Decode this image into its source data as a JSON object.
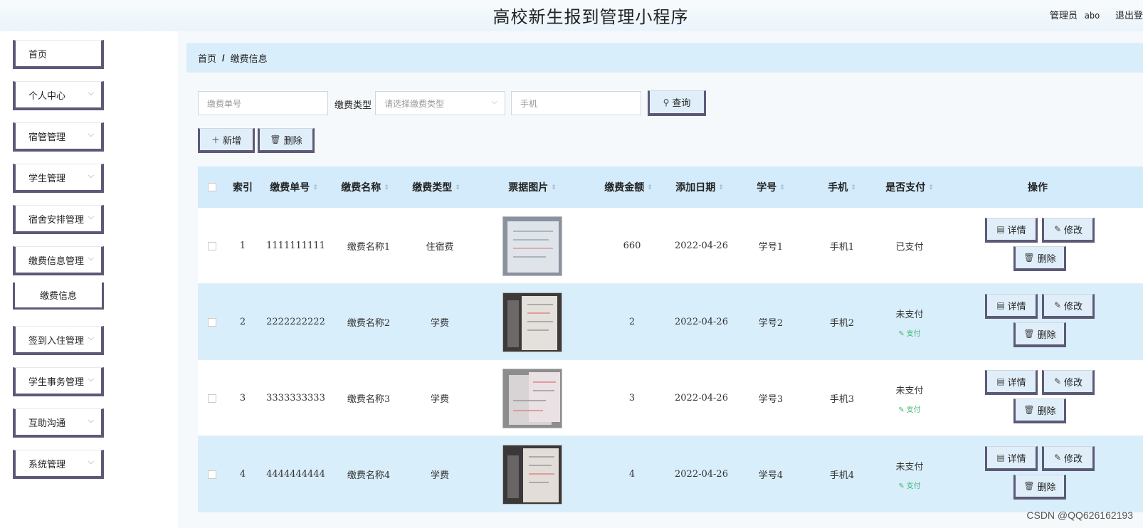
{
  "header": {
    "title": "高校新生报到管理小程序",
    "user_role": "管理员",
    "user_name": "abo",
    "logout": "退出登"
  },
  "sidebar": {
    "items": [
      {
        "label": "首页"
      },
      {
        "label": "个人中心"
      },
      {
        "label": "宿管管理"
      },
      {
        "label": "学生管理"
      },
      {
        "label": "宿舍安排管理"
      },
      {
        "label": "缴费信息管理"
      },
      {
        "label": "缴费信息"
      },
      {
        "label": "签到入住管理"
      },
      {
        "label": "学生事务管理"
      },
      {
        "label": "互助沟通"
      },
      {
        "label": "系统管理"
      }
    ]
  },
  "breadcrumb": {
    "home": "首页",
    "sep": "/",
    "current": "缴费信息"
  },
  "filters": {
    "order_placeholder": "缴费单号",
    "type_label": "缴费类型",
    "type_placeholder": "请选择缴费类型",
    "phone_placeholder": "手机",
    "search_label": "查询"
  },
  "actions": {
    "add_label": "新增",
    "delete_label": "删除"
  },
  "table": {
    "columns": [
      "索引",
      "缴费单号",
      "缴费名称",
      "缴费类型",
      "票据图片",
      "缴费金额",
      "添加日期",
      "学号",
      "手机",
      "是否支付",
      "操作"
    ],
    "rows": [
      {
        "index": "1",
        "order": "1111111111",
        "name": "缴费名称1",
        "type": "住宿费",
        "amount": "660",
        "date": "2022-04-26",
        "student": "学号1",
        "phone": "手机1",
        "status": "已支付",
        "pay": ""
      },
      {
        "index": "2",
        "order": "2222222222",
        "name": "缴费名称2",
        "type": "学费",
        "amount": "2",
        "date": "2022-04-26",
        "student": "学号2",
        "phone": "手机2",
        "status": "未支付",
        "pay": "支付"
      },
      {
        "index": "3",
        "order": "3333333333",
        "name": "缴费名称3",
        "type": "学费",
        "amount": "3",
        "date": "2022-04-26",
        "student": "学号3",
        "phone": "手机3",
        "status": "未支付",
        "pay": "支付"
      },
      {
        "index": "4",
        "order": "4444444444",
        "name": "缴费名称4",
        "type": "学费",
        "amount": "4",
        "date": "2022-04-26",
        "student": "学号4",
        "phone": "手机4",
        "status": "未支付",
        "pay": "支付"
      }
    ],
    "op_labels": {
      "detail": "详情",
      "edit": "修改",
      "delete": "删除"
    }
  },
  "watermark": "CSDN @QQ626162193"
}
